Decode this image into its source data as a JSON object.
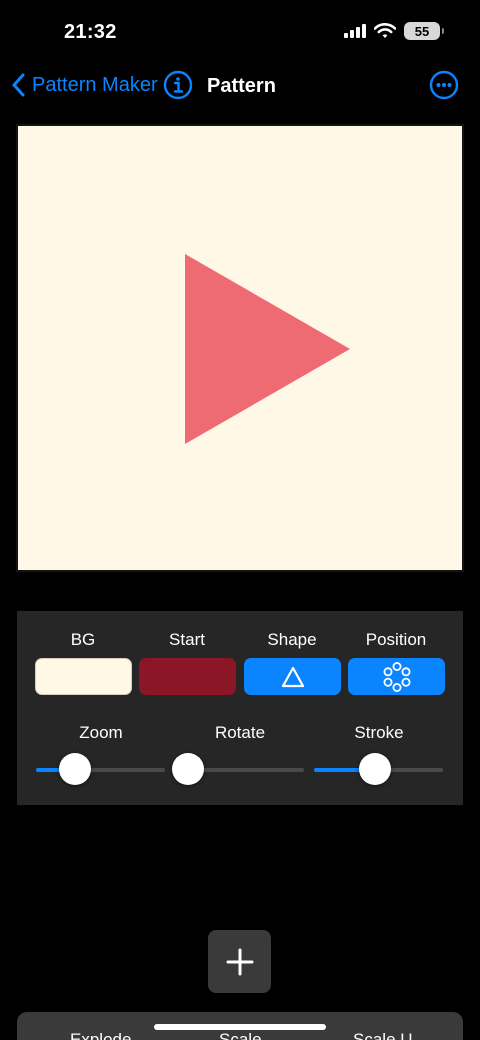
{
  "status_bar": {
    "time": "21:32",
    "battery": "55"
  },
  "nav": {
    "back_label": "Pattern Maker",
    "title": "Pattern"
  },
  "colors": {
    "accent": "#0a84ff",
    "canvas_bg": "#fff8e6",
    "shape_fill": "#ef6b73"
  },
  "swatches": [
    {
      "label": "BG",
      "color": "#fff8e6"
    },
    {
      "label": "Start",
      "color": "#8b1626"
    },
    {
      "label": "Shape",
      "color": "#0a84ff",
      "icon": "triangle-outline-icon"
    },
    {
      "label": "Position",
      "color": "#0a84ff",
      "icon": "circle-ring-icon"
    }
  ],
  "sliders": [
    {
      "label": "Zoom",
      "value": 0.3
    },
    {
      "label": "Rotate",
      "value": 0.1
    },
    {
      "label": "Stroke",
      "value": 0.47
    }
  ],
  "bottom_tabs": [
    "Explode",
    "Scale",
    "Scale U"
  ]
}
